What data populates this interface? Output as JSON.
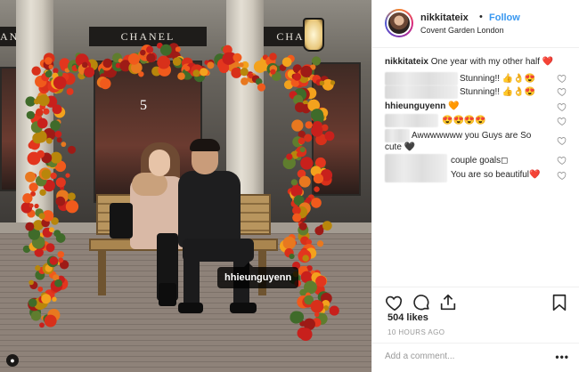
{
  "photo": {
    "storefront_signs": [
      "ANEL",
      "CHANEL",
      "CHA"
    ],
    "window_number": "5",
    "tag_username": "hhieunguyenn"
  },
  "header": {
    "username": "nikkitateix",
    "separator": "•",
    "follow_label": "Follow",
    "location": "Covent Garden London"
  },
  "caption": {
    "username": "nikkitateix",
    "text": "One year with my other half ❤️"
  },
  "comments": [
    {
      "username": "",
      "text": "Stunning!! 👍👌😍"
    },
    {
      "username": "",
      "text": "Stunning!! 👍👌😍"
    },
    {
      "username": "hhieunguyenn",
      "text": "🧡"
    },
    {
      "username": "",
      "text": "😍😍😍😍"
    },
    {
      "username": "",
      "text": "Awwwwwww you Guys are So cute 🖤"
    },
    {
      "username": "",
      "text": "couple goals◻"
    },
    {
      "username": "",
      "text": "You are so beautiful❤️"
    }
  ],
  "footer": {
    "likes": "504 likes",
    "timestamp": "10 HOURS AGO",
    "comment_placeholder": "Add a comment...",
    "more": "•••"
  },
  "colors": {
    "follow": "#3897f0",
    "text": "#262626",
    "muted": "#999999",
    "heart": "#ed4956"
  },
  "icons": [
    "heart-icon",
    "comment-icon",
    "share-icon",
    "bookmark-icon",
    "more-options-icon",
    "user-tag-icon"
  ]
}
